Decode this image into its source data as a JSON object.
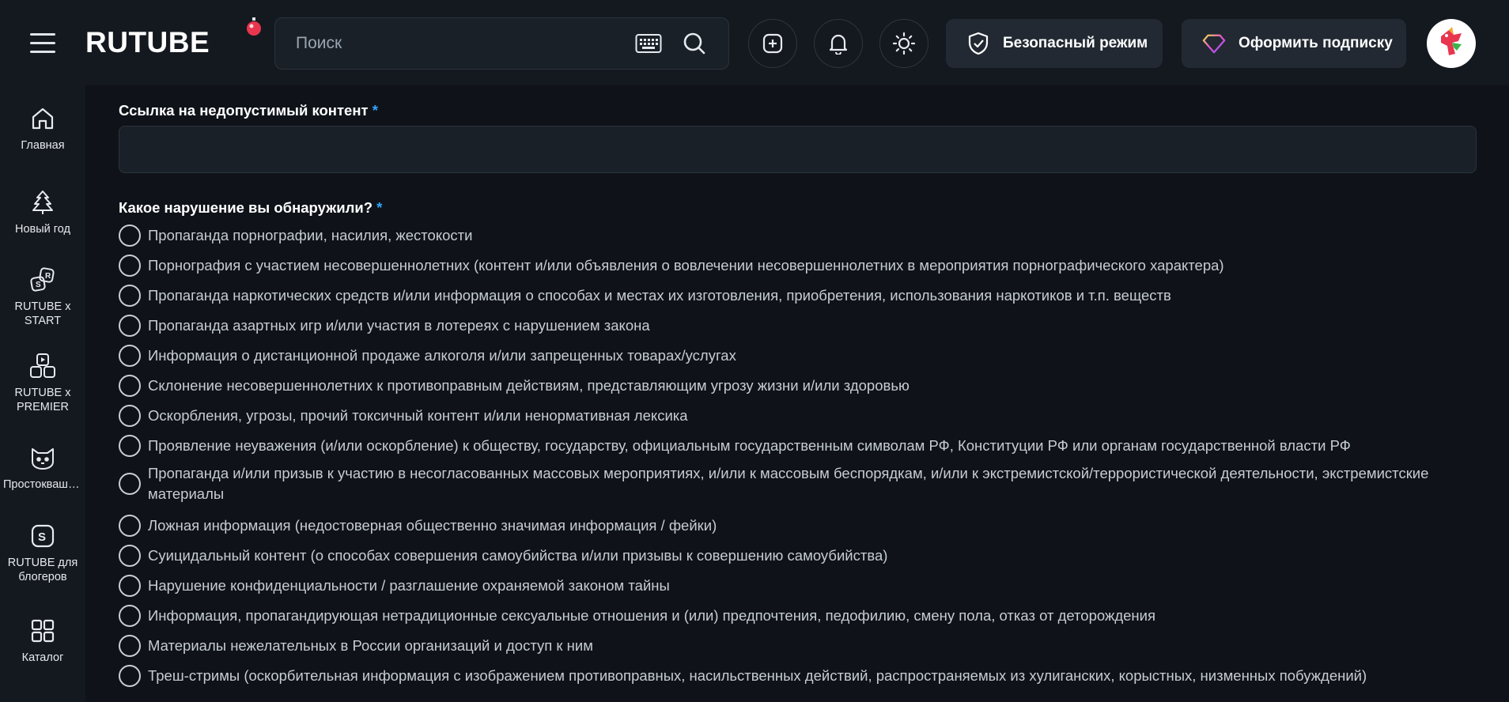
{
  "header": {
    "logo_text": "RUTUBE",
    "search_placeholder": "Поиск",
    "safe_mode_label": "Безопасный режим",
    "subscribe_label": "Оформить подписку"
  },
  "sidebar": {
    "items": [
      {
        "label": "Главная",
        "icon": "home-icon"
      },
      {
        "label": "Новый год",
        "icon": "christmas-tree-icon"
      },
      {
        "label": "RUTUBE x START",
        "icon": "rutube-start-icon"
      },
      {
        "label": "RUTUBE x PREMIER",
        "icon": "rutube-premier-icon"
      },
      {
        "label": "Простоквашино",
        "icon": "cat-icon"
      },
      {
        "label": "RUTUBE для блогеров",
        "icon": "rutube-studio-icon"
      },
      {
        "label": "Каталог",
        "icon": "grid-icon"
      }
    ]
  },
  "form": {
    "link_label": "Ссылка на недопустимый контент",
    "link_value": "",
    "required_mark": "*",
    "violation_label": "Какое нарушение вы обнаружили?",
    "options": [
      "Пропаганда порнографии, насилия, жестокости",
      "Порнография с участием несовершеннолетних (контент и/или объявления о вовлечении несовершеннолетних в мероприятия порнографического характера)",
      "Пропаганда наркотических средств и/или информация о способах и местах их изготовления, приобретения, использования наркотиков и т.п. веществ",
      "Пропаганда азартных игр и/или участия в лотереях с нарушением закона",
      "Информация о дистанционной продаже алкоголя и/или запрещенных товарах/услугах",
      "Склонение несовершеннолетних к противоправным действиям, представляющим угрозу жизни и/или здоровью",
      "Оскорбления, угрозы, прочий токсичный контент и/или ненормативная лексика",
      "Проявление неуважения (и/или оскорбление) к обществу, государству, официальным государственным символам РФ, Конституции РФ или органам государственной власти РФ",
      "Пропаганда и/или призыв к участию в несогласованных массовых мероприятиях, и/или к массовым беспорядкам, и/или к экстремистской/террористической деятельности, экстремистские материалы",
      "Ложная информация (недостоверная общественно значимая информация / фейки)",
      "Суицидальный контент (о способах совершения самоубийства и/или призывы к совершению самоубийства)",
      "Нарушение конфиденциальности / разглашение охраняемой законом тайны",
      "Информация, пропагандирующая нетрадиционные сексуальные отношения и (или) предпочтения, педофилию, смену пола, отказ от деторождения",
      "Материалы нежелательных в России организаций и доступ к ним",
      "Треш-стримы (оскорбительная информация с изображением противоправных, насильственных действий, распространяемых из хулиганских, корыстных, низменных побуждений)"
    ]
  },
  "colors": {
    "background": "#14191f",
    "main_background": "#0f1319",
    "accent": "#31a5ff",
    "input_background": "#1a2028"
  }
}
